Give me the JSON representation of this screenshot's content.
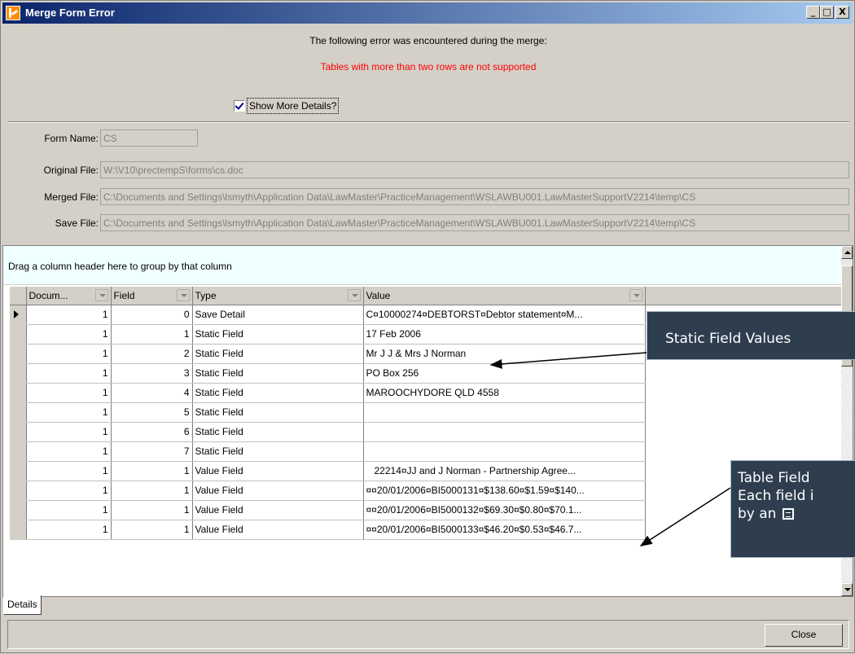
{
  "window": {
    "title": "Merge Form Error",
    "minimize_glyph": "_",
    "maximize_glyph": "□",
    "close_glyph": "X"
  },
  "message": {
    "intro": "The following error was encountered during the merge:",
    "error": "Tables with more than two rows are not supported",
    "error_color": "#ff0000"
  },
  "details_checkbox": {
    "label": "Show More Details?",
    "checked": true
  },
  "form_fields": [
    {
      "label": "Form Name:",
      "value": "CS"
    },
    {
      "label": "Original File:",
      "value": "W:\\V10\\prectempS\\forms\\cs.doc"
    },
    {
      "label": "Merged File:",
      "value": "C:\\Documents and Settings\\lsmyth\\Application Data\\LawMaster\\PracticeManagement\\WSLAWBU001.LawMasterSupportV2214\\temp\\CS"
    },
    {
      "label": "Save File:",
      "value": "C:\\Documents and Settings\\lsmyth\\Application Data\\LawMaster\\PracticeManagement\\WSLAWBU001.LawMasterSupportV2214\\temp\\CS"
    }
  ],
  "grid": {
    "group_hint": "Drag a column header here to group by that column",
    "columns": [
      "Docum...",
      "Field",
      "Type",
      "Value"
    ],
    "rows": [
      {
        "doc": "1",
        "field": "0",
        "type": "Save Detail",
        "value": "C¤10000274¤DEBTORST¤Debtor statement¤M..."
      },
      {
        "doc": "1",
        "field": "1",
        "type": "Static Field",
        "value": "17 Feb 2006"
      },
      {
        "doc": "1",
        "field": "2",
        "type": "Static Field",
        "value": "Mr J J & Mrs J Norman"
      },
      {
        "doc": "1",
        "field": "3",
        "type": "Static Field",
        "value": "PO Box 256"
      },
      {
        "doc": "1",
        "field": "4",
        "type": "Static Field",
        "value": "MAROOCHYDORE QLD  4558"
      },
      {
        "doc": "1",
        "field": "5",
        "type": "Static Field",
        "value": ""
      },
      {
        "doc": "1",
        "field": "6",
        "type": "Static Field",
        "value": ""
      },
      {
        "doc": "1",
        "field": "7",
        "type": "Static Field",
        "value": ""
      },
      {
        "doc": "1",
        "field": "1",
        "type": "Value Field",
        "value": "   22214¤JJ and J Norman - Partnership Agree..."
      },
      {
        "doc": "1",
        "field": "1",
        "type": "Value Field",
        "value": "¤¤20/01/2006¤BI5000131¤$138.60¤$1.59¤$140..."
      },
      {
        "doc": "1",
        "field": "1",
        "type": "Value Field",
        "value": "¤¤20/01/2006¤BI5000132¤$69.30¤$0.80¤$70.1..."
      },
      {
        "doc": "1",
        "field": "1",
        "type": "Value Field",
        "value": "¤¤20/01/2006¤BI5000133¤$46.20¤$0.53¤$46.7..."
      }
    ]
  },
  "tabs": [
    "Details"
  ],
  "buttons": {
    "close": "Close"
  },
  "callouts": {
    "static": "Static Field Values",
    "table_lines": [
      "Table Field",
      "Each field i",
      "by an"
    ],
    "color": "#2e3e4f"
  }
}
